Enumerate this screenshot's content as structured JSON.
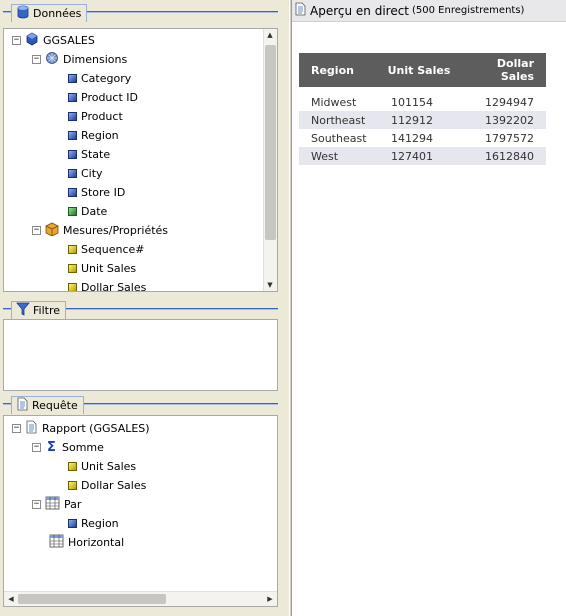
{
  "donnees": {
    "title": "Données",
    "tree": {
      "root": "GGSALES",
      "dimensions_label": "Dimensions",
      "dimensions": [
        "Category",
        "Product ID",
        "Product",
        "Region",
        "State",
        "City",
        "Store ID",
        "Date"
      ],
      "measures_label": "Mesures/Propriétés",
      "measures": [
        "Sequence#",
        "Unit Sales",
        "Dollar Sales"
      ]
    }
  },
  "filtre": {
    "title": "Filtre"
  },
  "requete": {
    "title": "Requête",
    "rapport": "Rapport (GGSALES)",
    "somme": "Somme",
    "somme_items": [
      "Unit Sales",
      "Dollar Sales"
    ],
    "par": "Par",
    "par_items": [
      "Region"
    ],
    "horizontal": "Horizontal"
  },
  "preview": {
    "title": "Aperçu en direct",
    "count": "(500 Enregistrements)",
    "columns": [
      "Region",
      "Unit Sales",
      "Dollar Sales"
    ],
    "rows": [
      [
        "Midwest",
        "101154",
        "1294947"
      ],
      [
        "Northeast",
        "112912",
        "1392202"
      ],
      [
        "Southeast",
        "141294",
        "1797572"
      ],
      [
        "West",
        "127401",
        "1612840"
      ]
    ]
  },
  "colors": {
    "accent": "#3a66b7",
    "table_header": "#5d5d5d",
    "row_alt": "#e6e6ef"
  }
}
